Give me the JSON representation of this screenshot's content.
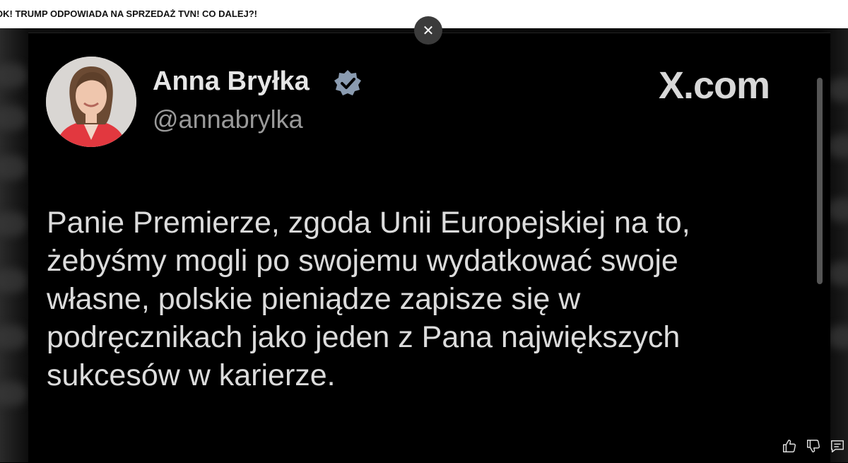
{
  "video_title": "OK! TRUMP ODPOWIADA NA SPRZEDAŻ TVN! CO DALEJ?!",
  "close_icon": "close-icon",
  "tweet": {
    "display_name": "Anna Bryłka",
    "handle": "@annabrylka",
    "brand": "X.com",
    "verified": true,
    "verified_color": "#8a9bb0",
    "text_lines": [
      "Panie Premierze, zgoda Unii Europejskiej na to,",
      "żebyśmy mogli po swojemu wydatkować swoje",
      "własne, polskie pieniądze zapisze się w",
      "podręcznikach jako jeden z Pana największych",
      "sukcesów w karierze."
    ]
  },
  "actions": {
    "icons": [
      "thumbs-up-icon",
      "thumbs-down-icon",
      "comment-icon"
    ]
  }
}
